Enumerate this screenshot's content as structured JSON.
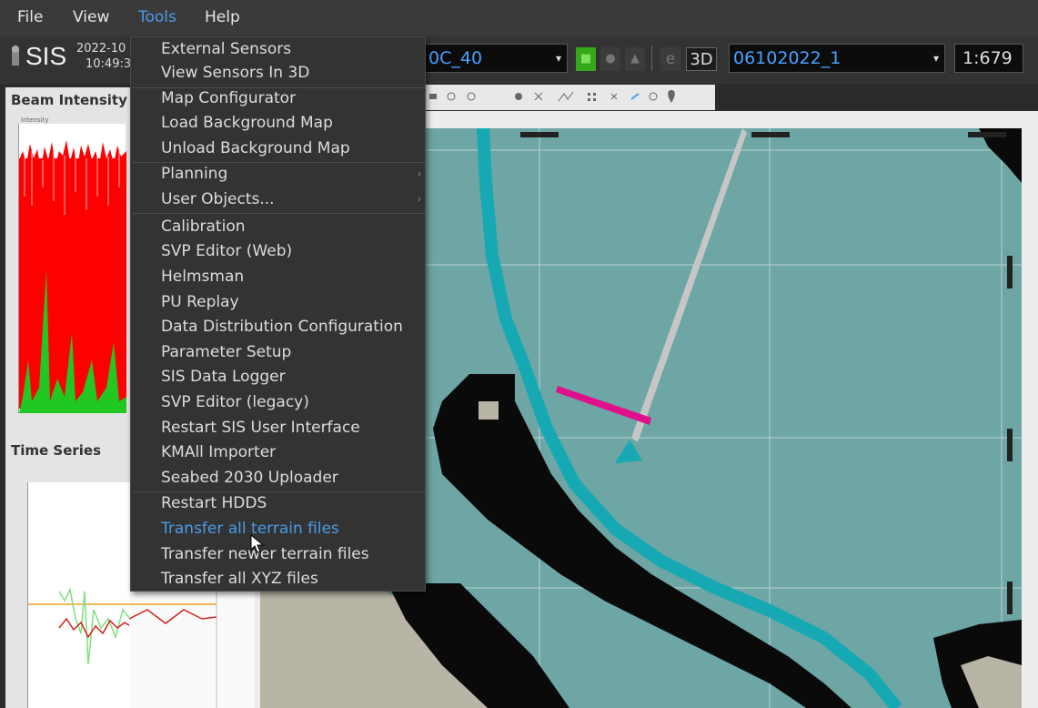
{
  "menubar": {
    "items": [
      "File",
      "View",
      "Tools",
      "Help"
    ]
  },
  "header": {
    "app_name": "SIS",
    "date": "2022-10",
    "time": "10:49:3",
    "survey_select": "0C_40",
    "line_select": "06102022_1",
    "scale": "1:679",
    "e_label": "e",
    "threed_label": "3D"
  },
  "panels": {
    "beam_title": "Beam Intensity",
    "beam_axis": "Intensity",
    "timeseries_title": "Time Series"
  },
  "tools_menu": {
    "items": [
      {
        "label": "External Sensors"
      },
      {
        "label": "View Sensors In 3D"
      },
      {
        "label": "Map Configurator"
      },
      {
        "label": "Load Background Map"
      },
      {
        "label": "Unload Background Map"
      },
      {
        "label": "Planning",
        "submenu": true
      },
      {
        "label": "User Objects...",
        "submenu": true
      },
      {
        "label": "Calibration"
      },
      {
        "label": "SVP Editor (Web)"
      },
      {
        "label": "Helmsman"
      },
      {
        "label": "PU Replay"
      },
      {
        "label": "Data Distribution Configuration"
      },
      {
        "label": "Parameter Setup"
      },
      {
        "label": "SIS Data Logger"
      },
      {
        "label": "SVP Editor (legacy)"
      },
      {
        "label": "Restart SIS User Interface"
      },
      {
        "label": "KMAll Importer"
      },
      {
        "label": "Seabed 2030 Uploader"
      },
      {
        "label": "Restart HDDS"
      },
      {
        "label": "Transfer all terrain files",
        "highlighted": true
      },
      {
        "label": "Transfer newer terrain files"
      },
      {
        "label": "Transfer all XYZ files"
      }
    ],
    "submenu_arrow": "›"
  },
  "colors": {
    "menu_bg": "#333333",
    "highlight": "#4a9be8",
    "accent_green": "#36a81c",
    "map_water": "#6ea5a5",
    "track_cyan": "#16a9b4"
  }
}
